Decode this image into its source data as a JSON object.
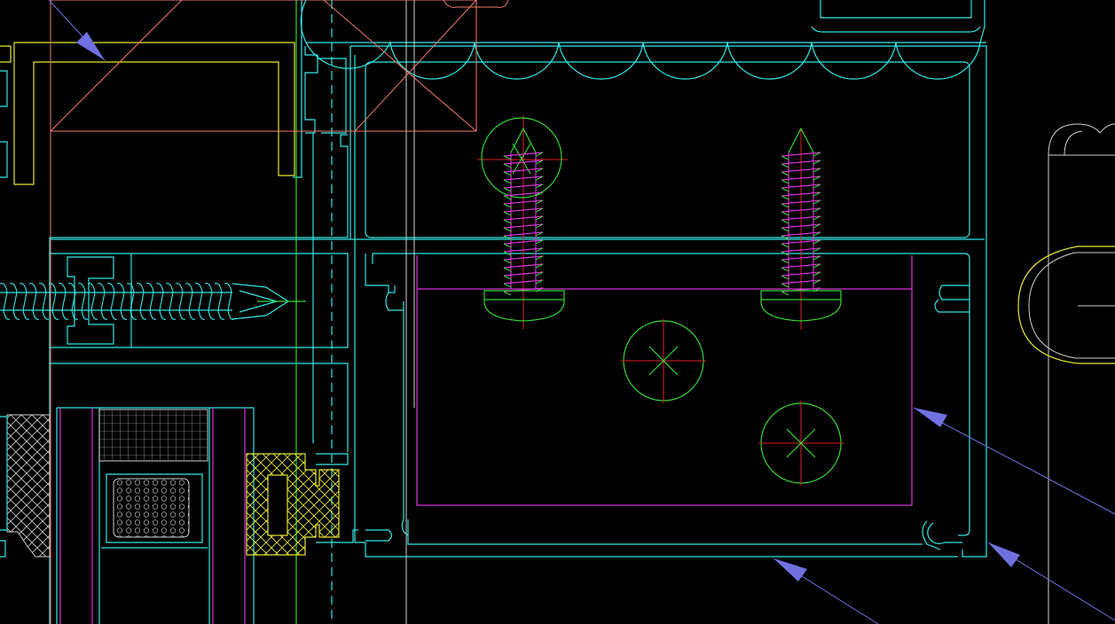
{
  "drawing": {
    "background": "#000000",
    "layers": {
      "profile": "#33e6e6",
      "gasket": "#d633d6",
      "centerline": "#33d633",
      "axis": "#e02020",
      "seal": "#e6e633",
      "insulation": "#ef7a6a",
      "outline": "#cfcfcf",
      "leader": "#7070e0"
    }
  },
  "components": {
    "screws_vertical": 2,
    "screw_horizontal": 1,
    "screw_holes": 3,
    "leader_arrows": 4
  }
}
